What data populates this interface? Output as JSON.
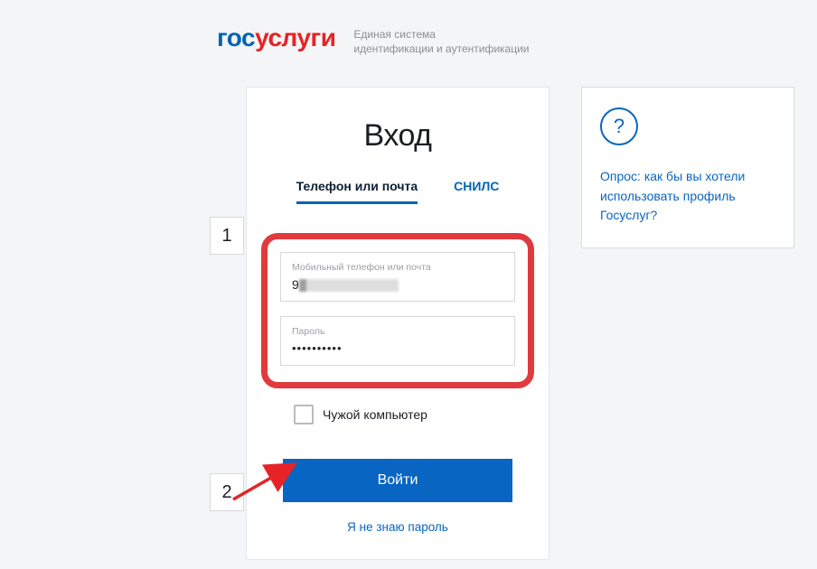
{
  "header": {
    "logo_part1": "гос",
    "logo_part2": "услуги",
    "tagline_line1": "Единая система",
    "tagline_line2": "идентификации и аутентификации"
  },
  "login": {
    "title": "Вход",
    "tabs": {
      "phone_email": "Телефон или почта",
      "snils": "СНИЛС"
    },
    "fields": {
      "login_label": "Мобильный телефон или почта",
      "login_value_prefix": "9",
      "password_label": "Пароль",
      "password_value": "••••••••••"
    },
    "checkbox_label": "Чужой компьютер",
    "submit": "Войти",
    "forgot": "Я не знаю пароль"
  },
  "sidebar": {
    "icon": "?",
    "prompt": "Опрос: как бы вы хотели использовать профиль Госуслуг?"
  },
  "annotations": {
    "marker1": "1",
    "marker2": "2"
  }
}
